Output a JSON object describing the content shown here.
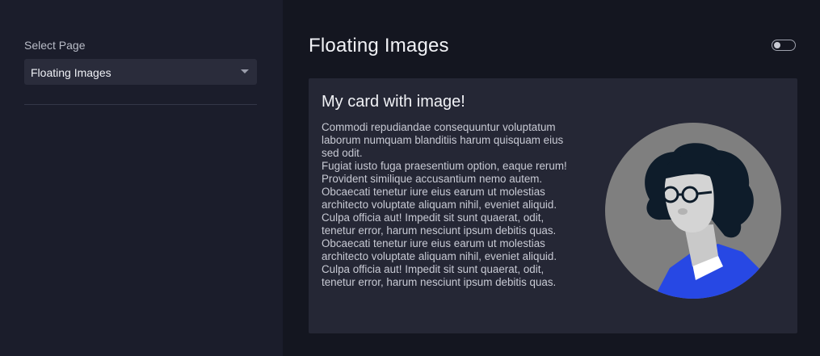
{
  "sidebar": {
    "select_label": "Select Page",
    "select_value": "Floating Images"
  },
  "main": {
    "title": "Floating Images",
    "theme_toggle": {
      "state": "off"
    }
  },
  "card": {
    "title": "My card with image!",
    "lines": [
      "Commodi repudiandae consequuntur voluptatum",
      "laborum numquam blanditiis harum quisquam eius",
      "sed odit.",
      "Fugiat iusto fuga praesentium option, eaque rerum!",
      "Provident similique accusantium nemo autem.",
      "Obcaecati tenetur iure eius earum ut molestias",
      "architecto voluptate aliquam nihil, eveniet aliquid.",
      "Culpa officia aut! Impedit sit sunt quaerat, odit,",
      "tenetur error, harum nesciunt ipsum debitis quas.",
      "Obcaecati tenetur iure eius earum ut molestias",
      "architecto voluptate aliquam nihil, eveniet aliquid.",
      "Culpa officia aut! Impedit sit sunt quaerat, odit,",
      "tenetur error, harum nesciunt ipsum debitis quas."
    ],
    "image": {
      "icon": "woman-with-glasses-illustration"
    }
  },
  "colors": {
    "sidebar_bg": "#1b1d2b",
    "main_bg": "#141620",
    "card_bg": "#252735",
    "select_bg": "#2a2c3b",
    "accent_blue": "#2748e4"
  }
}
